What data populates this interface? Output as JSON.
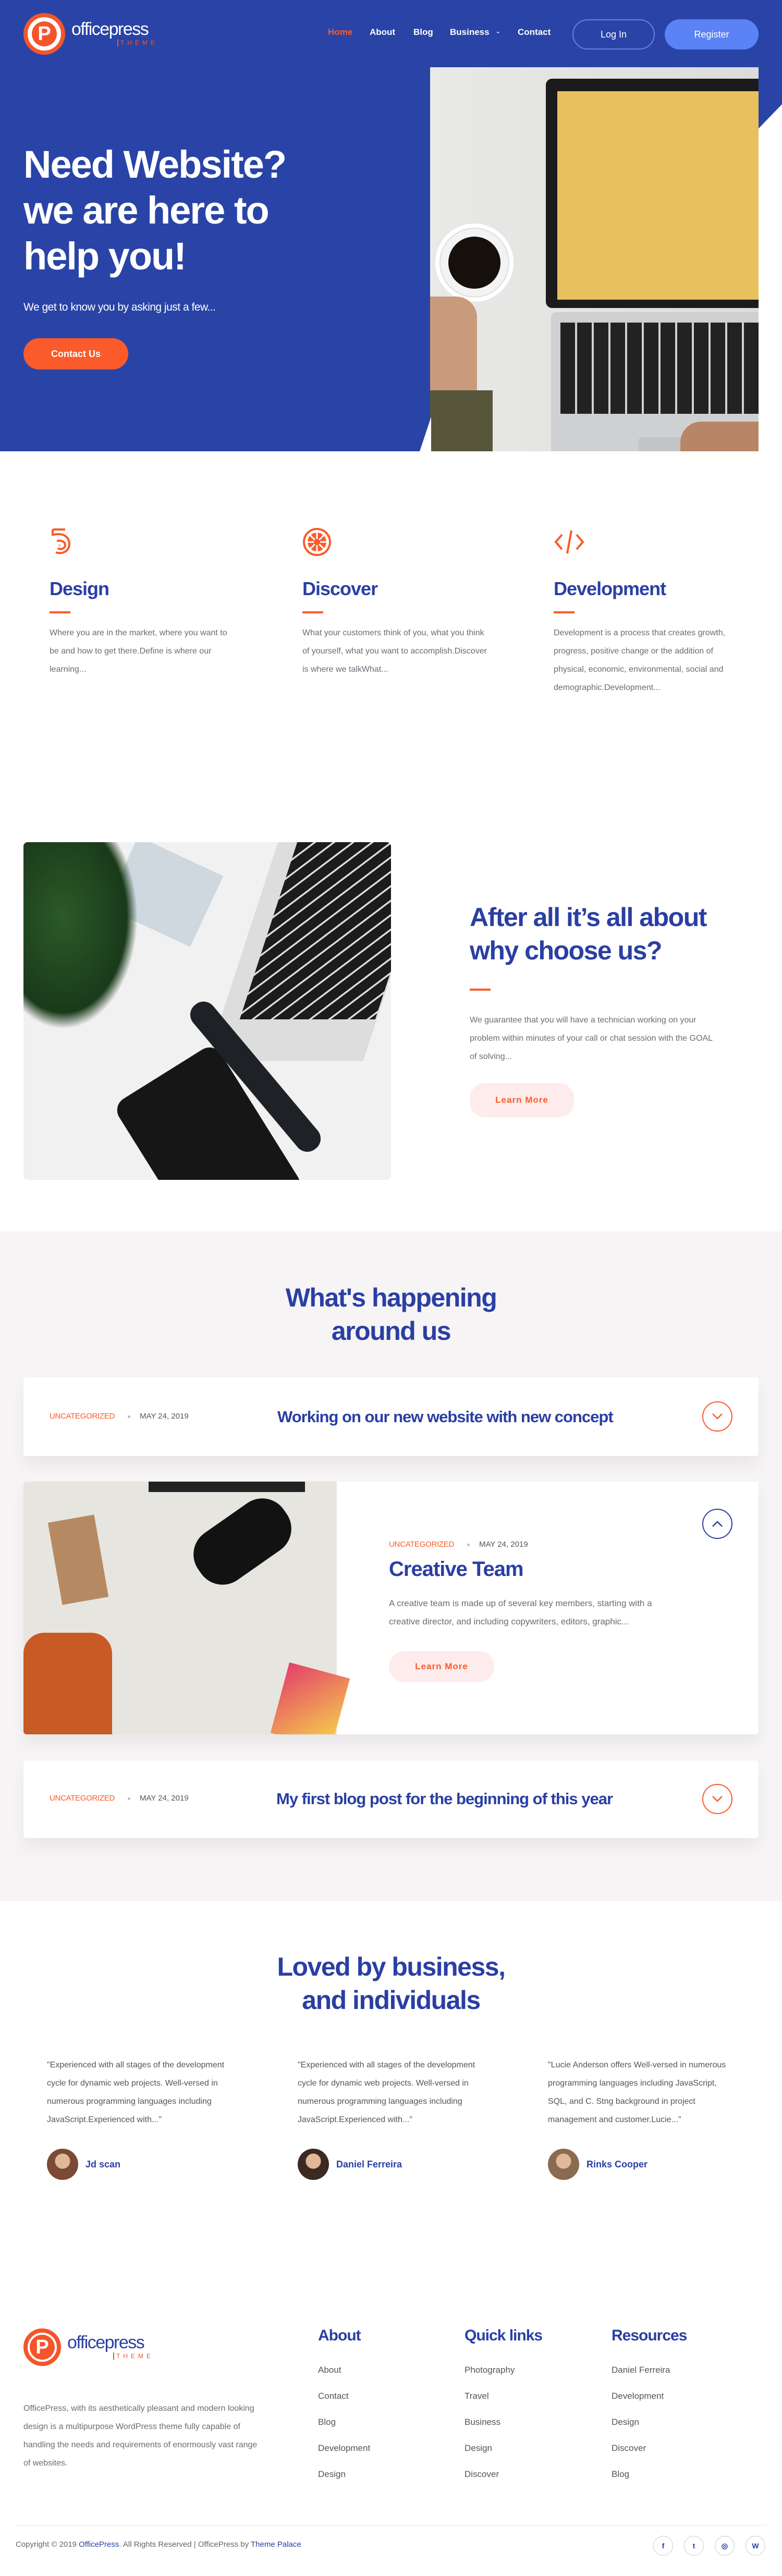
{
  "brand": {
    "name": "officepress",
    "sub": "THEME",
    "mark": "P"
  },
  "colors": {
    "primary": "#2944a6",
    "accent": "#fb5a2a",
    "button": "#5b83f5"
  },
  "nav": {
    "items": [
      {
        "label": "Home",
        "active": true
      },
      {
        "label": "About"
      },
      {
        "label": "Blog"
      },
      {
        "label": "Business"
      },
      {
        "label": "Contact"
      }
    ],
    "login": "Log In",
    "register": "Register"
  },
  "hero": {
    "line1": "Need Website?",
    "line2": "we are here to",
    "line3": "help you!",
    "subtitle": "We get to know you by asking just a few...",
    "cta": "Contact Us"
  },
  "features": [
    {
      "icon": "spiral-five-icon",
      "title": "Design",
      "text": "Where you are in the market, where you want to be and how to get there.Define is where our learning..."
    },
    {
      "icon": "emblem-icon",
      "title": "Discover",
      "text": "What your customers think of you, what you think of yourself, what you want to accomplish.Discover is where we talkWhat..."
    },
    {
      "icon": "code-icon",
      "title": "Development",
      "text": "Development is a process that creates growth, progress, positive change or the addition of physical, economic, environmental, social and demographic.Development..."
    }
  ],
  "why": {
    "line1": "After all it’s all about",
    "line2": "why choose us?",
    "text": "We guarantee that you will have a technician working on your problem within minutes of your call or chat session with the GOAL of solving...",
    "button": "Learn More"
  },
  "blog": {
    "line1": "What's happening",
    "line2": "around us",
    "posts": [
      {
        "category": "UNCATEGORIZED",
        "date": "MAY 24, 2019",
        "title": "Working on our new website with new concept"
      },
      {
        "category": "UNCATEGORIZED",
        "date": "MAY 24, 2019",
        "title": "Creative Team",
        "text": "A creative team is made up of several key members, starting with a creative director, and including copywriters, editors, graphic...",
        "button": "Learn More"
      },
      {
        "category": "UNCATEGORIZED",
        "date": "MAY 24, 2019",
        "title": "My first blog post for the beginning of this year"
      }
    ]
  },
  "testimonials": {
    "line1": "Loved by business,",
    "line2": "and individuals",
    "items": [
      {
        "quote": "\"Experienced with all stages of the development cycle for dynamic web projects. Well-versed in numerous programming languages including JavaScript.Experienced with...\"",
        "name": "Jd scan"
      },
      {
        "quote": "\"Experienced with all stages of the development cycle for dynamic web projects. Well-versed in numerous programming languages including JavaScript.Experienced with...\"",
        "name": "Daniel Ferreira"
      },
      {
        "quote": "\"Lucie Anderson offers Well-versed in numerous programming languages including JavaScript, SQL, and C. Stng background in project management and customer.Lucie...\"",
        "name": "Rinks Cooper"
      }
    ]
  },
  "footer": {
    "description": "OfficePress, with its aesthetically pleasant and modern looking design is a multipurpose WordPress theme fully capable of handling the needs and requirements of enormously vast range of websites.",
    "columns": [
      {
        "title": "About",
        "links": [
          "About",
          "Contact",
          "Blog",
          "Development",
          "Design"
        ]
      },
      {
        "title": "Quick links",
        "links": [
          "Photography",
          "Travel",
          "Business",
          "Design",
          "Discover"
        ]
      },
      {
        "title": "Resources",
        "links": [
          "Daniel Ferreira",
          "Development",
          "Design",
          "Discover",
          "Blog"
        ]
      }
    ],
    "copyright_prefix": "Copyright © 2019 ",
    "copyright_brand": "OfficePress",
    "copyright_mid": ". All Rights Reserved | OfficePress by ",
    "copyright_link": "Theme Palace",
    "social": [
      {
        "icon": "facebook-icon",
        "glyph": "f"
      },
      {
        "icon": "twitter-icon",
        "glyph": "t"
      },
      {
        "icon": "instagram-icon",
        "glyph": "◎"
      },
      {
        "icon": "wordpress-icon",
        "glyph": "W"
      }
    ]
  }
}
